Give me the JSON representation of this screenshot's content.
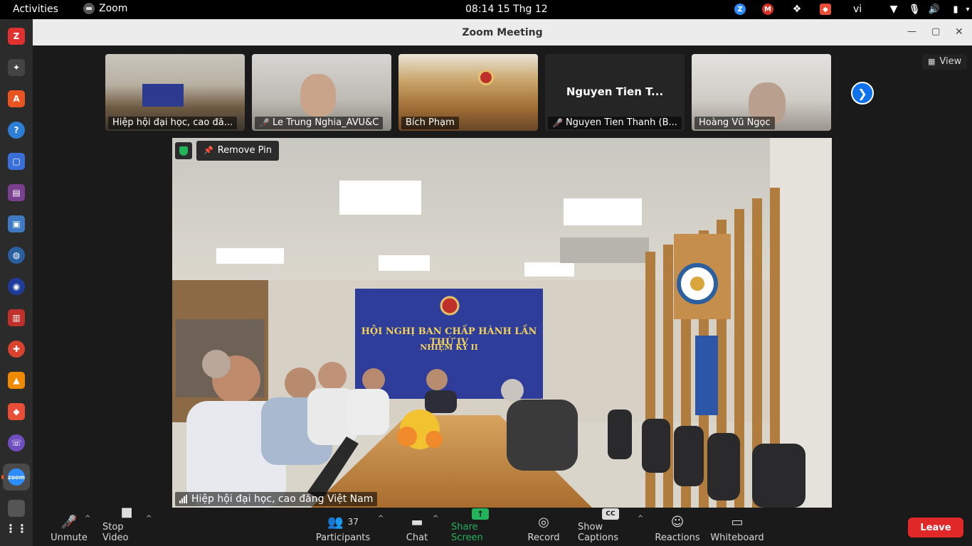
{
  "topbar": {
    "activities": "Activities",
    "app_name": "Zoom",
    "clock": "08:14  15 Thg 12",
    "lang": "vi"
  },
  "window": {
    "title": "Zoom Meeting"
  },
  "gallery": {
    "view_label": "View",
    "tiles": [
      {
        "name": "Hiệp hội đại học, cao đă...",
        "muted": false
      },
      {
        "name": "Le Trung Nghia_AVU&C",
        "muted": true
      },
      {
        "name": "Bích Phạm",
        "muted": false
      },
      {
        "name": "Nguyen Tien Thanh (B...",
        "muted": true,
        "center_name": "Nguyen Tien T..."
      },
      {
        "name": "Hoàng Vũ Ngọc",
        "muted": false
      }
    ]
  },
  "main_video": {
    "remove_pin": "Remove Pin",
    "participant": "Hiệp hội đại học, cao đăng Việt Nam",
    "banner_title": "HỘI NGHỊ BAN CHẤP HÀNH LẦN THỨ IV",
    "banner_subtitle": "NHIỆM KỲ II"
  },
  "toolbar": {
    "unmute": "Unmute",
    "stop_video": "Stop Video",
    "participants": "Participants",
    "participants_count": "37",
    "chat": "Chat",
    "share_screen": "Share Screen",
    "record": "Record",
    "show_captions": "Show Captions",
    "captions_icon": "CC",
    "reactions": "Reactions",
    "whiteboard": "Whiteboard",
    "leave": "Leave"
  },
  "colors": {
    "accent_blue": "#0e72ed",
    "share_green": "#23b35a",
    "leave_red": "#e02828",
    "ubuntu_orange": "#e95420"
  }
}
